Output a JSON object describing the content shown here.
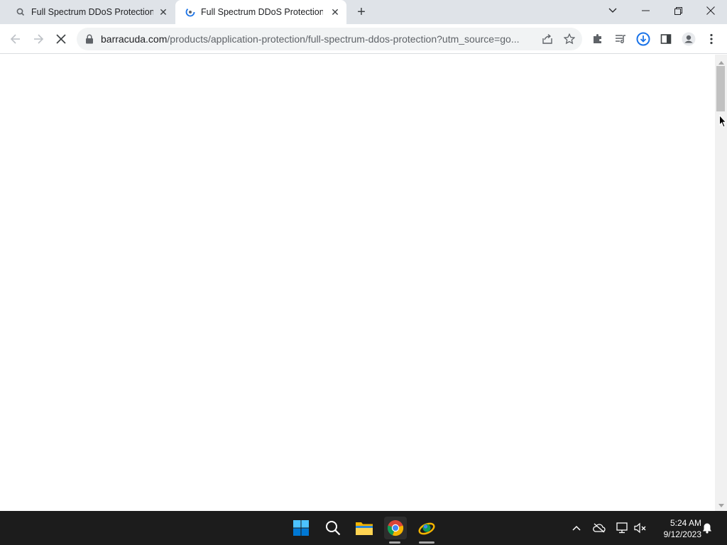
{
  "browser": {
    "tabs": [
      {
        "title": "Full Spectrum DDoS Protection |",
        "active": false
      },
      {
        "title": "Full Spectrum DDoS Protection |",
        "active": true
      }
    ],
    "address": {
      "host": "barracuda.com",
      "path": "/products/application-protection/full-spectrum-ddos-protection?utm_source=go..."
    }
  },
  "taskbar": {
    "time": "5:24 AM",
    "date": "9/12/2023"
  },
  "colors": {
    "tabstrip": "#dfe3e8",
    "taskbar": "#1c1c1c",
    "download_accent": "#1a73e8"
  },
  "icons": [
    "search-icon",
    "close-icon",
    "plus-icon",
    "chevron-down-icon",
    "minimize-icon",
    "restore-icon",
    "back-arrow-icon",
    "forward-arrow-icon",
    "stop-icon",
    "lock-icon",
    "share-icon",
    "star-icon",
    "puzzle-icon",
    "media-queue-icon",
    "download-icon",
    "side-panel-icon",
    "profile-icon",
    "kebab-menu-icon",
    "windows-start-icon",
    "folder-icon",
    "chrome-icon",
    "app-icon",
    "chevron-up-icon",
    "cloud-off-icon",
    "network-icon",
    "volume-muted-icon",
    "bell-icon"
  ]
}
